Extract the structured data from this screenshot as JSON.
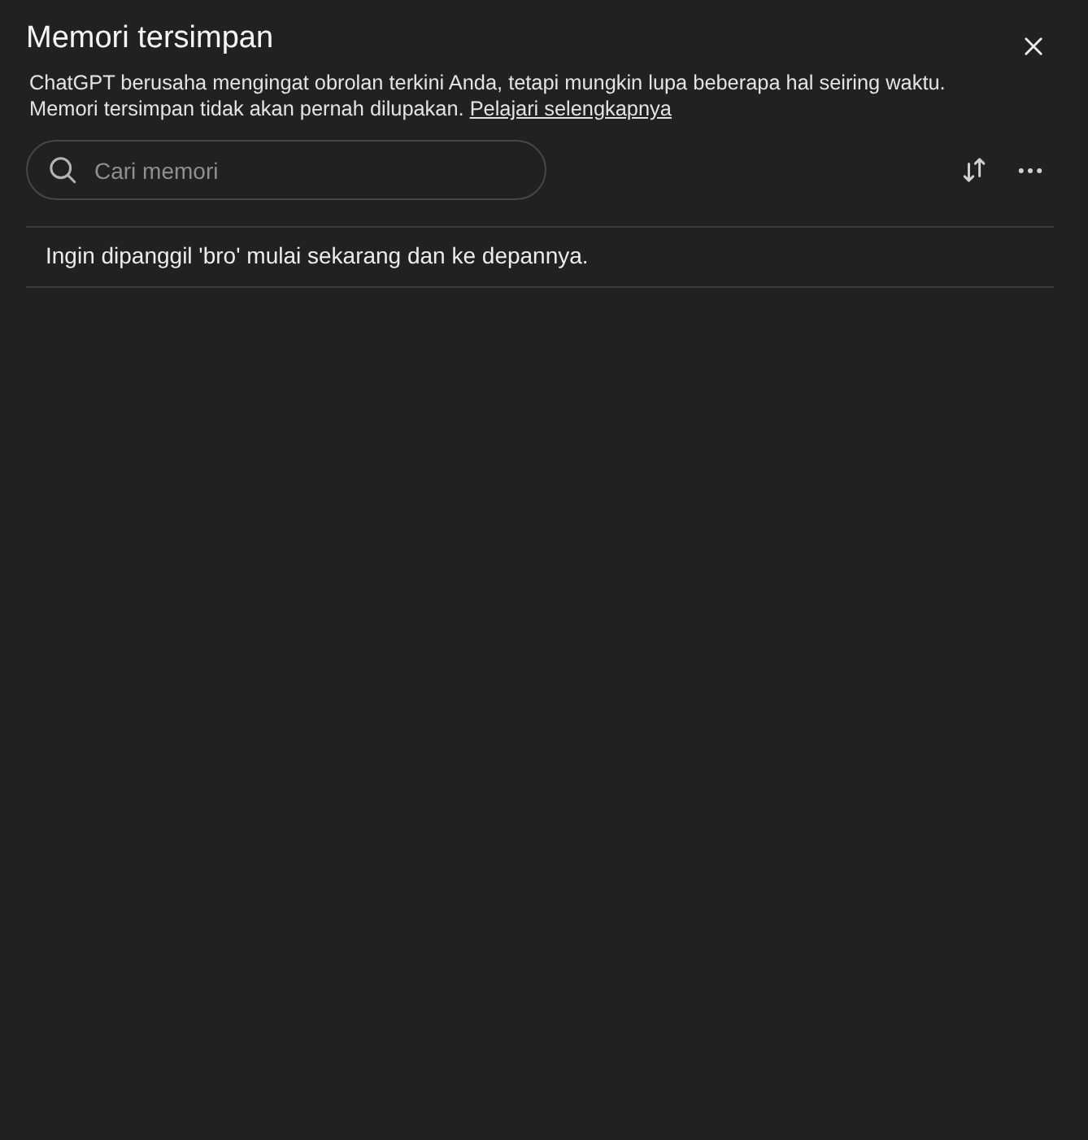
{
  "dialog": {
    "title": "Memori tersimpan",
    "description": "ChatGPT berusaha mengingat obrolan terkini Anda, tetapi mungkin lupa beberapa hal seiring waktu. Memori tersimpan tidak akan pernah dilupakan.",
    "link": "Pelajari selengkapnya"
  },
  "search": {
    "placeholder": "Cari memori"
  },
  "memories": [
    {
      "text": "Ingin dipanggil 'bro' mulai sekarang dan ke depannya."
    }
  ]
}
